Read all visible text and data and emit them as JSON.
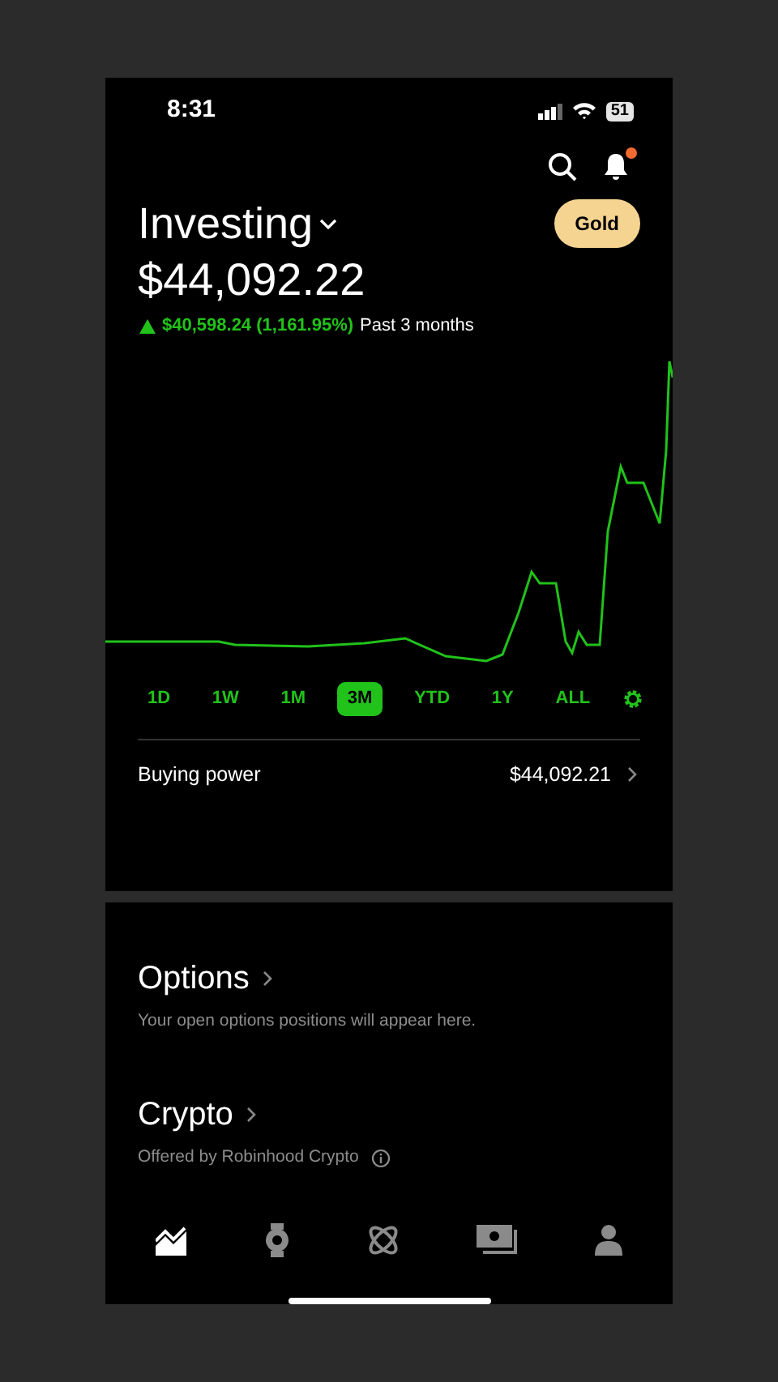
{
  "status_bar": {
    "time": "8:31",
    "battery": "51"
  },
  "header": {
    "notification_badge": true
  },
  "account": {
    "title": "Investing",
    "badge": "Gold",
    "value": "$44,092.22",
    "change": "$40,598.24 (1,161.95%)",
    "period": "Past 3 months"
  },
  "ranges": [
    {
      "label": "1D",
      "selected": false
    },
    {
      "label": "1W",
      "selected": false
    },
    {
      "label": "1M",
      "selected": false
    },
    {
      "label": "3M",
      "selected": true
    },
    {
      "label": "YTD",
      "selected": false
    },
    {
      "label": "1Y",
      "selected": false
    },
    {
      "label": "ALL",
      "selected": false
    }
  ],
  "buying_power": {
    "label": "Buying power",
    "value": "$44,092.21"
  },
  "sections": [
    {
      "title": "Options",
      "subtitle": "Your open options positions will appear here.",
      "info": false
    },
    {
      "title": "Crypto",
      "subtitle": "Offered by Robinhood Crypto",
      "info": true
    }
  ],
  "nav": [
    {
      "kind": "investing",
      "selected": true
    },
    {
      "kind": "watch",
      "selected": false
    },
    {
      "kind": "crypto",
      "selected": false
    },
    {
      "kind": "cash",
      "selected": false
    },
    {
      "kind": "account",
      "selected": false
    }
  ]
}
